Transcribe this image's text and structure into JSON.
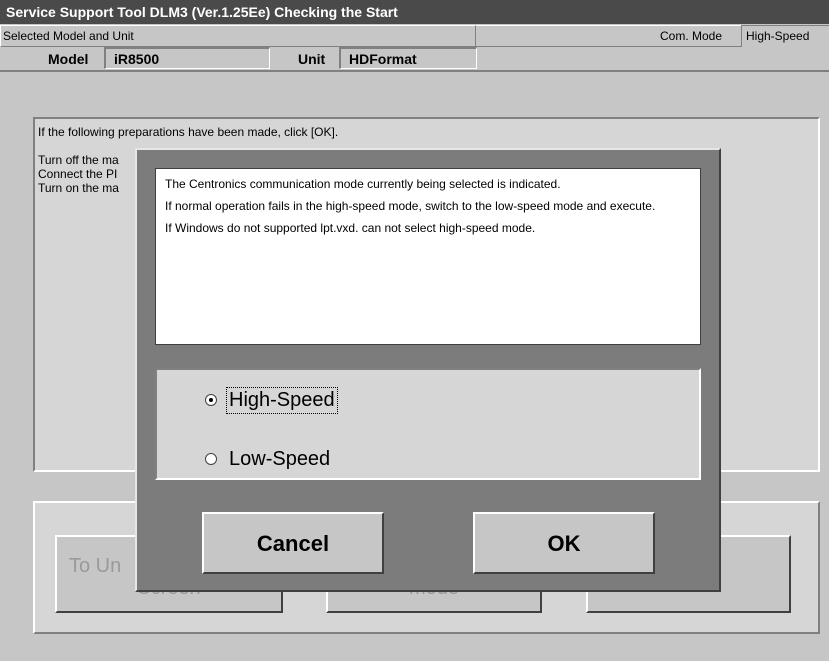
{
  "window": {
    "title": "Service Support Tool DLM3 (Ver.1.25Ee) Checking the Start"
  },
  "selection": {
    "label": "Selected Model and Unit",
    "model_label": "Model",
    "model_value": "iR8500",
    "unit_label": "Unit",
    "unit_value": "HDFormat",
    "com_mode_label": "Com. Mode",
    "com_mode_value": "High-Speed"
  },
  "instructions": {
    "lines": [
      "If the following preparations have been made, click [OK].",
      "",
      "Turn off the ma",
      "Connect the PI",
      "Turn on the ma"
    ]
  },
  "background_buttons": {
    "to_unit_top": "To Un",
    "to_unit_bottom": "Screen",
    "mode": "mode",
    "third": ""
  },
  "dialog": {
    "message": [
      "The Centronics communication mode currently being selected is indicated.",
      "If normal operation fails in the high-speed mode, switch to the low-speed mode and execute.",
      "If Windows do not supported lpt.vxd. can not select high-speed mode."
    ],
    "options": [
      {
        "label": "High-Speed",
        "checked": true
      },
      {
        "label": "Low-Speed",
        "checked": false
      }
    ],
    "cancel_label": "Cancel",
    "ok_label": "OK"
  }
}
